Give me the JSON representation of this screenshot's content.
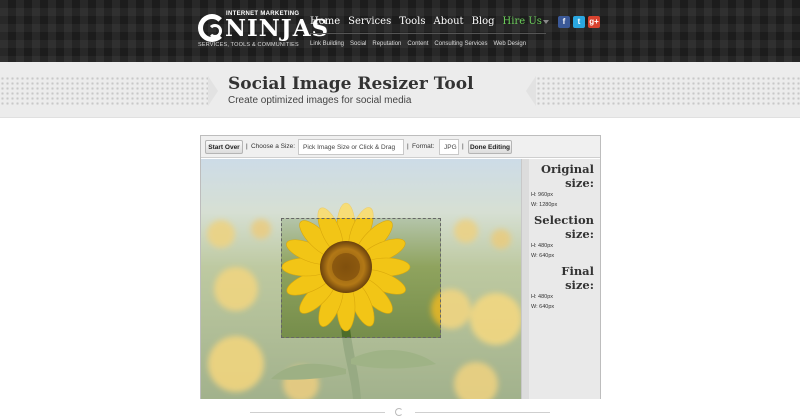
{
  "header": {
    "logo": {
      "tagline_top": "INTERNET MARKETING",
      "name": "NINJAS",
      "tagline_bottom": "SERVICES, TOOLS & COMMUNITIES"
    },
    "nav": [
      {
        "label": "Home"
      },
      {
        "label": "Services"
      },
      {
        "label": "Tools"
      },
      {
        "label": "About"
      },
      {
        "label": "Blog"
      },
      {
        "label": "Hire Us"
      }
    ],
    "subnav": [
      {
        "label": "Link Building"
      },
      {
        "label": "Social"
      },
      {
        "label": "Reputation"
      },
      {
        "label": "Content"
      },
      {
        "label": "Consulting Services"
      },
      {
        "label": "Web Design"
      }
    ],
    "social": {
      "facebook": "f",
      "twitter": "t",
      "googleplus": "g+"
    },
    "colors": {
      "hire_us": "#6ccf5b",
      "facebook": "#3b5998",
      "twitter": "#2aa7e0",
      "googleplus": "#d9432f"
    }
  },
  "banner": {
    "title": "Social Image Resizer Tool",
    "subtitle": "Create optimized images for social media"
  },
  "tool": {
    "toolbar": {
      "start_over": "Start Over",
      "sep1": "|",
      "choose_size_label": "Choose a Size:",
      "size_value": "Pick Image Size or Click & Drag",
      "sep2": "|",
      "format_label": "Format:",
      "format_value": "JPG",
      "sep3": "|",
      "done_editing": "Done Editing"
    },
    "image": {
      "icon": "sunflower-photo"
    },
    "info": {
      "original": {
        "title": "Original size:",
        "h": "H: 960px",
        "w": "W: 1280px"
      },
      "selection": {
        "title": "Selection size:",
        "h": "H: 480px",
        "w": "W: 640px"
      },
      "final": {
        "title": "Final size:",
        "h": "H: 480px",
        "w": "W: 640px"
      }
    }
  }
}
